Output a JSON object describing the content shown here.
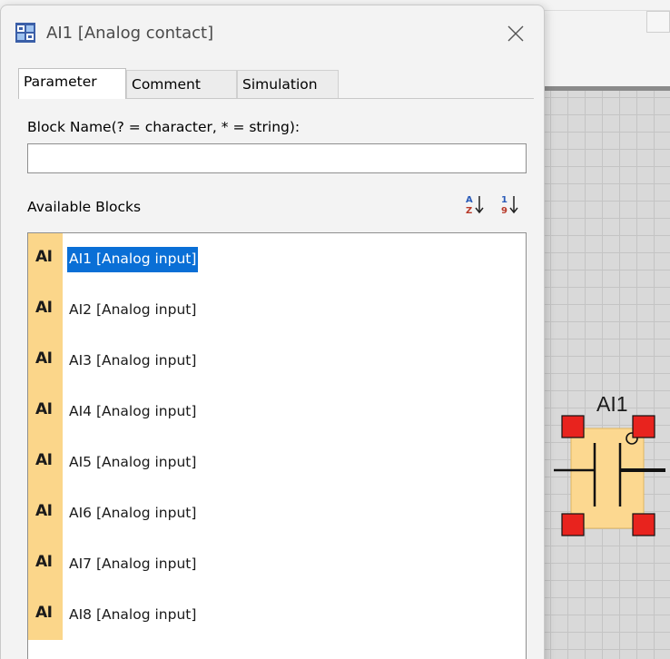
{
  "dialog": {
    "title": "AI1 [Analog contact]",
    "tabs": [
      {
        "label": "Parameter",
        "active": true
      },
      {
        "label": "Comment",
        "active": false
      },
      {
        "label": "Simulation",
        "active": false
      }
    ],
    "block_name_label": "Block Name(? = character, * = string):",
    "block_name_value": "",
    "available_blocks_label": "Available Blocks",
    "sort_icons": [
      "sort-alpha-icon",
      "sort-numeric-icon"
    ],
    "blocks": [
      {
        "badge": "AI",
        "label": "AI1 [Analog input]",
        "selected": true
      },
      {
        "badge": "AI",
        "label": "AI2 [Analog input]",
        "selected": false
      },
      {
        "badge": "AI",
        "label": "AI3 [Analog input]",
        "selected": false
      },
      {
        "badge": "AI",
        "label": "AI4 [Analog input]",
        "selected": false
      },
      {
        "badge": "AI",
        "label": "AI5 [Analog input]",
        "selected": false
      },
      {
        "badge": "AI",
        "label": "AI6 [Analog input]",
        "selected": false
      },
      {
        "badge": "AI",
        "label": "AI7 [Analog input]",
        "selected": false
      },
      {
        "badge": "AI",
        "label": "AI8 [Analog input]",
        "selected": false
      }
    ]
  },
  "canvas": {
    "block_label": "AI1"
  },
  "colors": {
    "selection": "#0a6fd6",
    "badge": "#fbd68a",
    "handle": "#e8231e",
    "block_fill": "#fcd890"
  }
}
